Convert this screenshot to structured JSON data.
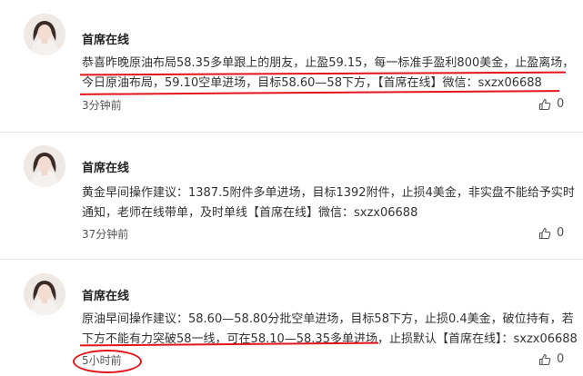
{
  "colors": {
    "annotation": "#e4141b",
    "text": "#333333",
    "divider": "#e6e6e6"
  },
  "posts": [
    {
      "author": "首席在线",
      "lines": [
        "恭喜昨晚原油布局58.35多单跟上的朋友，止盈59.15，每一标准手盈利800美金，止盈离场，",
        "今日原油布局，59.10空单进场，目标58.60—58下方，【首席在线】微信：sxzx06688"
      ],
      "time": "3分钟前",
      "likes": "0",
      "like_icon": "thumbs-up-icon"
    },
    {
      "author": "首席在线",
      "lines": [
        "黄金早间操作建议：1387.5附件多单进场，目标1392附件，止损4美金，非实盘不能给予实时",
        "通知，老师在线带单，及时单线【首席在线】微信：sxzx06688"
      ],
      "time": "37分钟前",
      "likes": "0",
      "like_icon": "thumbs-up-icon"
    },
    {
      "author": "首席在线",
      "lines": [
        "原油早间操作建议：58.60—58.80分批空单进场，目标58下方，止损0.4美金，破位持有，若",
        "下方不能有力突破58一线，可在58.10—58.35多单进场，止损默认【首席在线】：sxzx06688"
      ],
      "time": "5小时前",
      "likes": "0",
      "like_icon": "thumbs-up-icon"
    }
  ]
}
